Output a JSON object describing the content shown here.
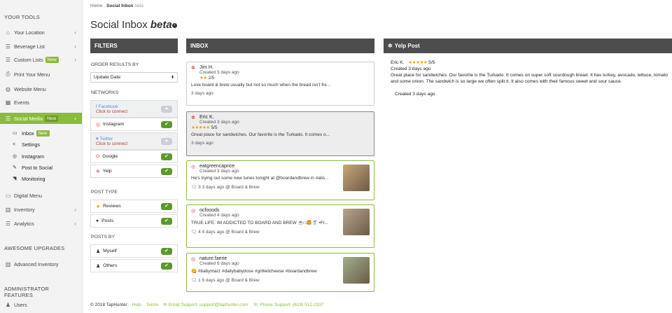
{
  "sidebar": {
    "your_tools": "YOUR TOOLS",
    "items": [
      {
        "label": "Your Location",
        "icon": "home-icon",
        "glyph": "⌂",
        "chev": "‹"
      },
      {
        "label": "Beverage List",
        "icon": "list-icon",
        "glyph": "☰",
        "chev": "‹"
      },
      {
        "label": "Custom Lists",
        "icon": "list-icon",
        "glyph": "☰",
        "chev": "‹",
        "badge": "New"
      },
      {
        "label": "Print Your Menu",
        "icon": "print-icon",
        "glyph": "⎙"
      },
      {
        "label": "Website Menu",
        "icon": "globe-icon",
        "glyph": "◍"
      },
      {
        "label": "Events",
        "icon": "calendar-icon",
        "glyph": "▦"
      },
      {
        "label": "Social Media",
        "icon": "list-icon",
        "glyph": "☰",
        "chev": "‹",
        "badge": "New"
      }
    ],
    "sub": [
      {
        "label": "Inbox",
        "icon": "inbox-icon",
        "glyph": "▭",
        "badge": "New"
      },
      {
        "label": "Settings",
        "icon": "share-icon",
        "glyph": "<"
      },
      {
        "label": "Instagram",
        "icon": "instagram-icon",
        "glyph": "◎"
      },
      {
        "label": "Post to Social",
        "icon": "edit-icon",
        "glyph": "✎"
      },
      {
        "label": "Monitoring",
        "icon": "rss-icon",
        "glyph": "◥"
      }
    ],
    "items2": [
      {
        "label": "Digital Menu",
        "icon": "tv-icon",
        "glyph": "▭"
      },
      {
        "label": "Inventory",
        "icon": "chart-icon",
        "glyph": "▥",
        "chev": "‹"
      },
      {
        "label": "Analytics",
        "icon": "list-icon",
        "glyph": "☰",
        "chev": "‹"
      }
    ],
    "awesome_upgrades": "AWESOME UPGRADES",
    "advanced_inventory": "Advanced Inventory",
    "admin_features": "ADMINISTRATOR FEATURES",
    "users": "Users"
  },
  "breadcrumb": {
    "home": "Home",
    "sep": "·",
    "current": "Social Inbox",
    "beta": "beta"
  },
  "page": {
    "title": "Social Inbox",
    "title_beta": "beta"
  },
  "filters": {
    "heading": "FILTERS",
    "order_label": "ORDER RESULTS BY",
    "order_value": "Update Date",
    "networks_label": "NETWORKS",
    "networks": [
      {
        "name": "Facebook",
        "connect": "Click to connect",
        "on": false,
        "icon": "facebook-icon",
        "glyph": "f"
      },
      {
        "name": "Instagram",
        "on": true,
        "icon": "instagram-icon",
        "glyph": "◎"
      },
      {
        "name": "Twitter",
        "connect": "Click to connect",
        "on": false,
        "icon": "twitter-icon",
        "glyph": "♥"
      },
      {
        "name": "Google",
        "on": true,
        "icon": "google-icon",
        "glyph": "G"
      },
      {
        "name": "Yelp",
        "on": true,
        "icon": "yelp-icon",
        "glyph": "✲"
      }
    ],
    "post_type_label": "POST TYPE",
    "post_types": [
      {
        "name": "Reviews",
        "on": true,
        "icon": "star-icon",
        "glyph": "★"
      },
      {
        "name": "Posts",
        "on": true,
        "icon": "comment-icon",
        "glyph": "●"
      }
    ],
    "posts_by_label": "POSTS BY",
    "posts_by": [
      {
        "name": "Myself",
        "on": true,
        "icon": "user-icon",
        "glyph": "♟"
      },
      {
        "name": "Others",
        "on": true,
        "icon": "users-icon",
        "glyph": "♟"
      }
    ]
  },
  "inbox": {
    "heading": "INBOX",
    "cards": [
      {
        "source": "yelp",
        "name": "Jim H.",
        "created": "Created 3 days ago",
        "rating": "2/5",
        "stars": 2,
        "body": "Love board & brew usually but not so much when the bread isn't fre...",
        "foot": "3 days ago"
      },
      {
        "source": "yelp",
        "name": "Eric K.",
        "created": "Created 3 days ago",
        "rating": "5/5",
        "stars": 5,
        "body": "Great place for sandwiches.  Our favorite is the Turkado.  It comes o...",
        "foot": "3 days ago"
      },
      {
        "source": "instagram",
        "name": "eatgreencaprice",
        "created": "Created 3 days ago",
        "body": "He's trying out some new tunes tonight at @boardandbrew in #alis...",
        "count": "3",
        "foot": "3 days ago @ Board & Brew"
      },
      {
        "source": "instagram",
        "name": "ocfooods",
        "created": "Created 4 days ago",
        "body": "TRUE LIFE: IM ADDICTED TO BOARD AND BREW ☕□🍔🥤 •Fr...",
        "count": "4",
        "foot": "4 days ago @ Board & Brew"
      },
      {
        "source": "instagram",
        "name": "nature.faerie",
        "created": "Created 6 days ago",
        "body": "😋 #babymarz #dailybabydose #grilledcheese #boardandbrew",
        "count": "1",
        "foot": "6 days ago @ Board & Brew"
      }
    ]
  },
  "yelp_post": {
    "heading": "Yelp Post",
    "name": "Eric K.",
    "rating": "5/5",
    "stars": 5,
    "created": "Created 3 days ago",
    "body": "Great place for sandwiches.  Our favorite is the Turkado.  It comes on super soft sourdough bread.  It has turkey, avocado, lettuce, tomato and some onion.  The sandwich is so large we often split it.  It also comes with their famous sweet and sour sauce.",
    "footer_created": "Created 3 days ago"
  },
  "footer": {
    "copyright": "© 2018 TapHunter",
    "help": "Help",
    "terms": "Terms",
    "email": "Email Support: support@taphunter.com",
    "phone": "Phone Support: (619) 512-2337"
  },
  "colors": {
    "accent": "#8bbb3d",
    "panel": "#4d4d4d",
    "star": "#e0a800",
    "toggle_on": "#5a9a2a"
  }
}
